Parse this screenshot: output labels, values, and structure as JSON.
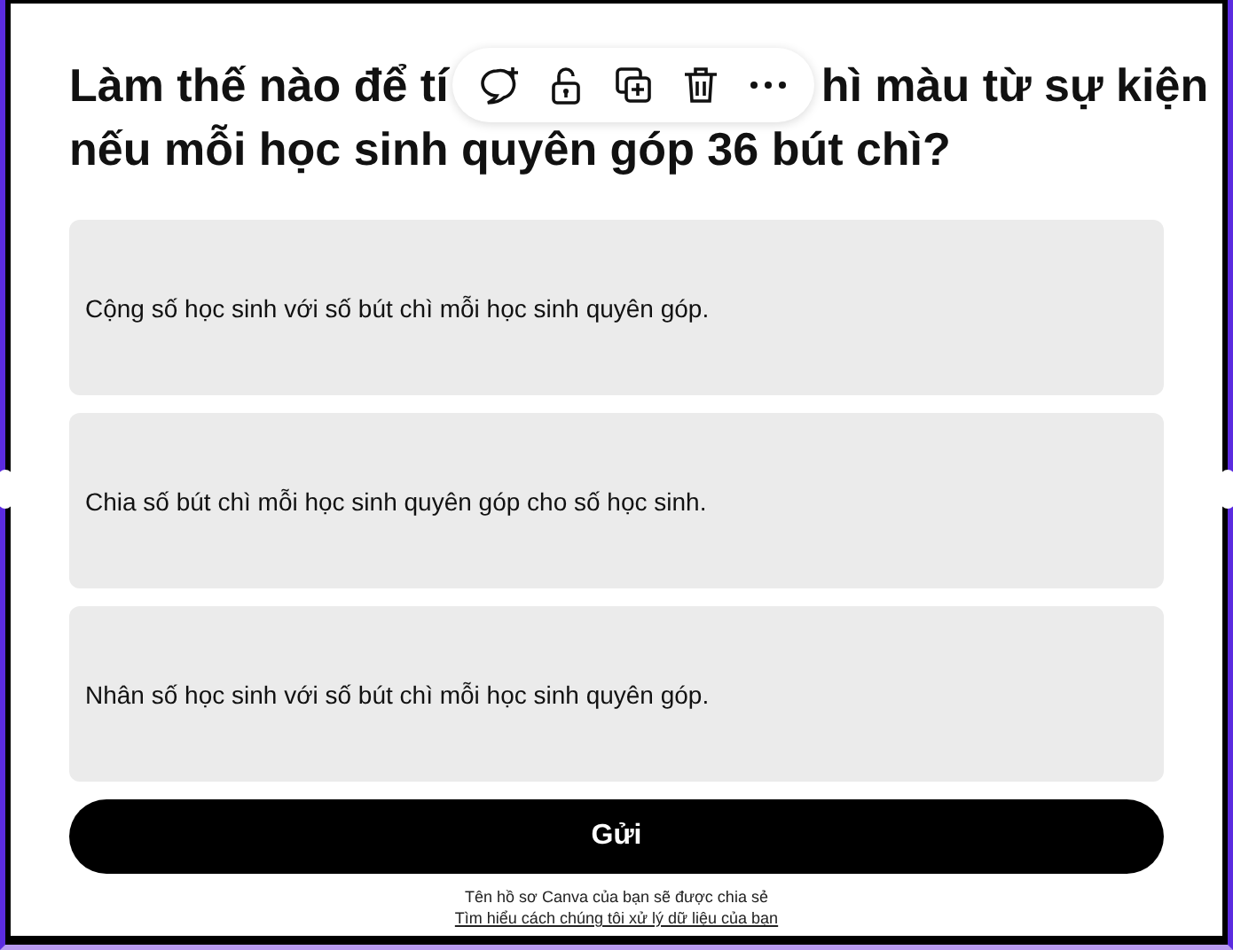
{
  "question": {
    "line1_start": "Làm thế nào để tí",
    "line1_end": "hì màu từ sự kiện",
    "line2": "nếu mỗi học sinh quyên góp 36 bút chì?"
  },
  "toolbar": {
    "items": [
      {
        "kind": "comment"
      },
      {
        "kind": "unlock"
      },
      {
        "kind": "duplicate"
      },
      {
        "kind": "trash"
      },
      {
        "kind": "more"
      }
    ]
  },
  "options": [
    {
      "text": "Cộng số học sinh với số bút chì mỗi học sinh quyên góp."
    },
    {
      "text": "Chia số bút chì mỗi học sinh quyên góp cho số học sinh."
    },
    {
      "text": "Nhân số học sinh với số bút chì mỗi học sinh quyên góp."
    }
  ],
  "submit": "Gửi",
  "footer": {
    "note": "Tên hồ sơ Canva của bạn sẽ được chia sẻ",
    "link": "Tìm hiểu cách chúng tôi xử lý dữ liệu của bạn"
  }
}
